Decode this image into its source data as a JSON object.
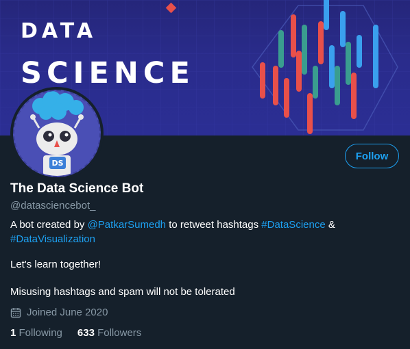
{
  "banner": {
    "title_line1": "DATA",
    "title_line2": "SCIENCE",
    "colors": {
      "background": "#2a2c8c",
      "bar_red": "#e8504a",
      "bar_teal": "#3a9d8f",
      "bar_blue": "#3aa0ee",
      "diamond": "#e8504a"
    }
  },
  "avatar": {
    "badge_text": "DS",
    "icon": "robot-icon"
  },
  "profile": {
    "follow_label": "Follow",
    "name": "The Data Science Bot",
    "handle": "@datasciencebot_"
  },
  "bio": {
    "text_1": "A bot created by ",
    "mention": "@PatkarSumedh",
    "text_2": " to retweet hashtags ",
    "hashtag_1": "#DataScience",
    "text_3": " &",
    "hashtag_2": "#DataVisualization",
    "line_2": "Let's learn together!",
    "line_3": "Misusing hashtags and spam will not be tolerated"
  },
  "meta": {
    "joined": "Joined June 2020",
    "joined_icon": "calendar-icon"
  },
  "stats": {
    "following_count": "1",
    "following_label": "Following",
    "followers_count": "633",
    "followers_label": "Followers"
  },
  "theme": {
    "background": "#15202b",
    "accent": "#1da1f2",
    "muted": "#8899a6",
    "text": "#ffffff"
  }
}
